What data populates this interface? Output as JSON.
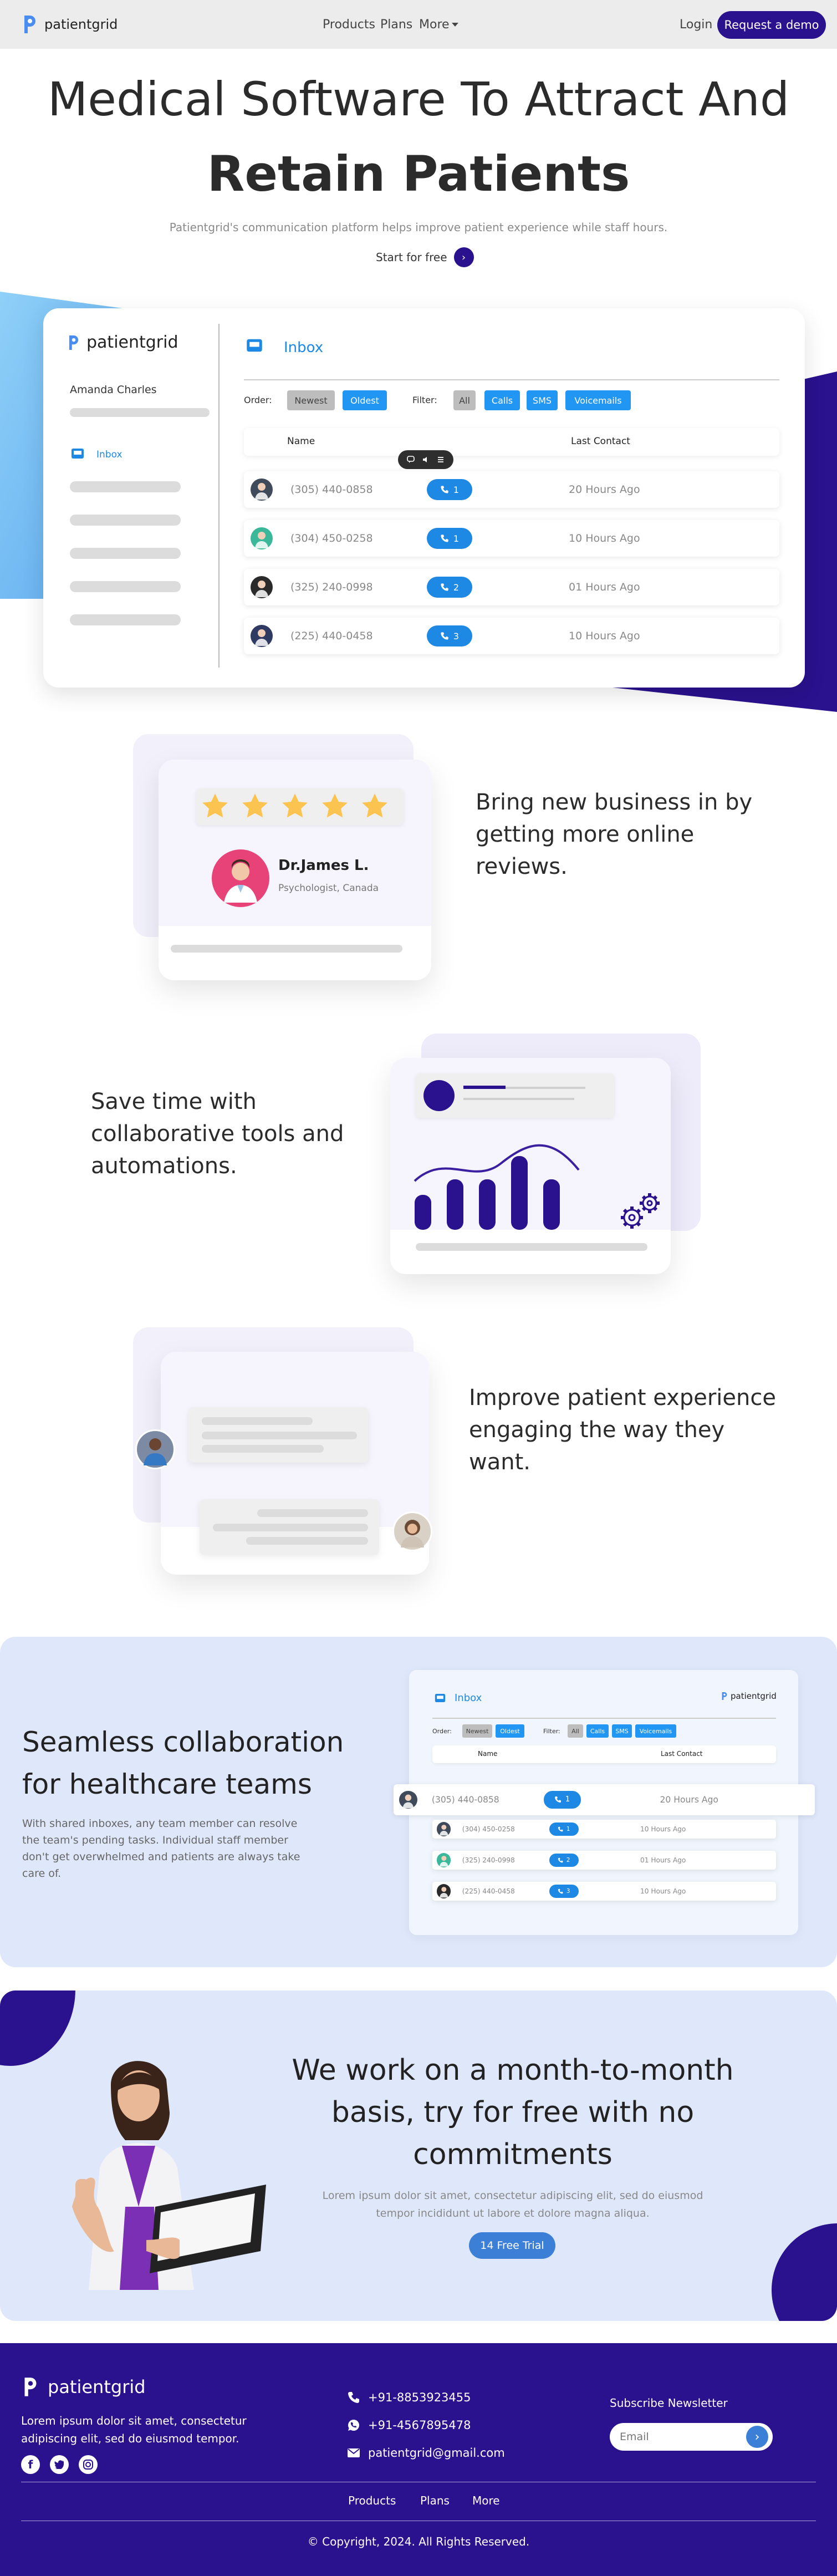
{
  "nav": {
    "brand": "patientgrid",
    "menu": [
      "Products",
      "Plans",
      "More"
    ],
    "login": "Login",
    "cta": "Request a demo"
  },
  "hero": {
    "title_line1": "Medical Software To Attract And",
    "title_line2": "Retain Patients",
    "subtitle": "Patientgrid's communication platform helps improve patient experience while staff hours.",
    "cta": "Start for free"
  },
  "dashboard": {
    "brand": "patientgrid",
    "user": "Amanda Charles",
    "sidebar_inbox": "Inbox",
    "panel_title": "Inbox",
    "order_label": "Order:",
    "order_options": [
      "Newest",
      "Oldest"
    ],
    "filter_label": "Filter:",
    "filter_options": [
      "All",
      "Calls",
      "SMS",
      "Voicemails"
    ],
    "col_name": "Name",
    "col_last": "Last Contact",
    "rows": [
      {
        "phone": "(305) 440-0858",
        "count": "1",
        "time": "20 Hours Ago"
      },
      {
        "phone": "(304) 450-0258",
        "count": "1",
        "time": "10 Hours Ago"
      },
      {
        "phone": "(325) 240-0998",
        "count": "2",
        "time": "01 Hours Ago"
      },
      {
        "phone": "(225) 440-0458",
        "count": "3",
        "time": "10 Hours Ago"
      }
    ]
  },
  "reviews": {
    "heading": "Bring new business in by getting more online reviews.",
    "reviewer_name": "Dr.James L.",
    "reviewer_role": "Psychologist, Canada",
    "stars": 5
  },
  "collab_tools": {
    "heading": "Save time with collaborative tools and automations.",
    "bar_values": [
      0.45,
      0.65,
      0.65,
      0.95,
      0.65
    ]
  },
  "patient_exp": {
    "heading": "Improve patient experience engaging the way they want."
  },
  "healthcare": {
    "heading": "Seamless collaboration for healthcare teams",
    "body": "With shared inboxes, any team member can resolve the team's pending tasks. Individual staff member don't get overwhelmed and patients are always take care of.",
    "mini": {
      "title": "Inbox",
      "brand": "patientgrid",
      "order_label": "Order:",
      "filter_label": "Filter:",
      "order_options": [
        "Newest",
        "Oldest"
      ],
      "filter_options": [
        "All",
        "Calls",
        "SMS",
        "Voicemails"
      ],
      "col_name": "Name",
      "col_last": "Last Contact",
      "rows": [
        {
          "phone": "(305) 440-0858",
          "count": "1",
          "time": "20 Hours Ago"
        },
        {
          "phone": "(304) 450-0258",
          "count": "1",
          "time": "10 Hours Ago"
        },
        {
          "phone": "(325) 240-0998",
          "count": "2",
          "time": "01 Hours Ago"
        },
        {
          "phone": "(225) 440-0458",
          "count": "3",
          "time": "10 Hours Ago"
        }
      ]
    }
  },
  "trial": {
    "heading_line1": "We work on a month-to-month",
    "heading_line2": "basis, try for free with no",
    "heading_line3": "commitments",
    "body_line1": "Lorem ipsum dolor sit amet, consectetur adipiscing elit, sed do eiusmod",
    "body_line2": "tempor incididunt ut labore et dolore magna aliqua.",
    "cta": "14 Free Trial"
  },
  "footer": {
    "brand": "patientgrid",
    "about_line1": "Lorem ipsum dolor sit amet, consectetur",
    "about_line2": "adipiscing elit, sed do eiusmod tempor.",
    "phone1": "+91-8853923455",
    "phone2": "+91-4567895478",
    "email": "patientgrid@gmail.com",
    "newsletter_title": "Subscribe Newsletter",
    "email_placeholder": "Email",
    "links": [
      "Products",
      "Plans",
      "More"
    ],
    "copyright": "© Copyright, 2024. All Rights Reserved."
  },
  "colors": {
    "brand_dark": "#2a118e",
    "accent_blue": "#1e88e5",
    "light_bg": "#dfe8fb",
    "star": "#fbc451"
  }
}
